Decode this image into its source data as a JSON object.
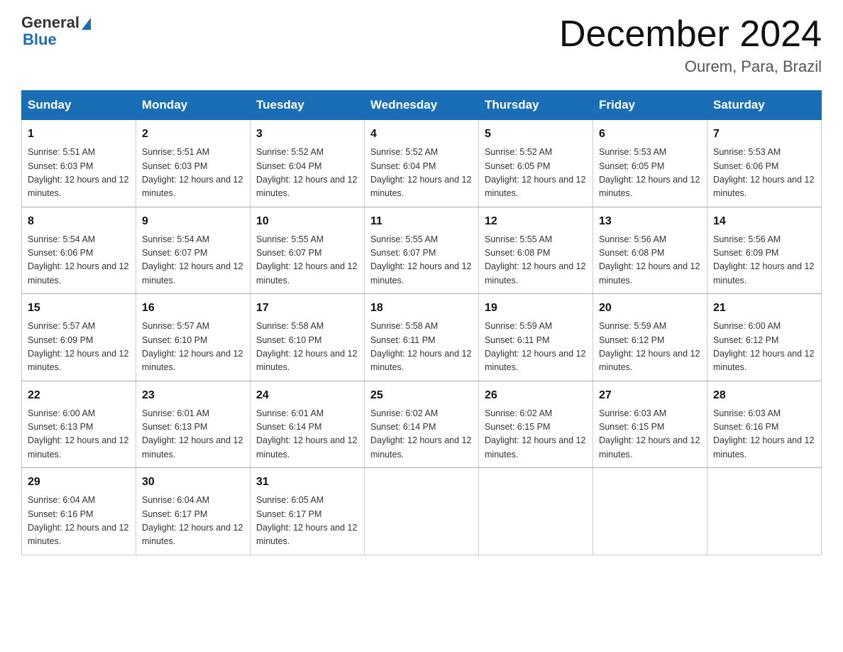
{
  "logo": {
    "text_general": "General",
    "text_blue": "Blue"
  },
  "header": {
    "title": "December 2024",
    "subtitle": "Ourem, Para, Brazil"
  },
  "days_of_week": [
    "Sunday",
    "Monday",
    "Tuesday",
    "Wednesday",
    "Thursday",
    "Friday",
    "Saturday"
  ],
  "weeks": [
    [
      {
        "day": "1",
        "sunrise": "5:51 AM",
        "sunset": "6:03 PM",
        "daylight": "12 hours and 12 minutes."
      },
      {
        "day": "2",
        "sunrise": "5:51 AM",
        "sunset": "6:03 PM",
        "daylight": "12 hours and 12 minutes."
      },
      {
        "day": "3",
        "sunrise": "5:52 AM",
        "sunset": "6:04 PM",
        "daylight": "12 hours and 12 minutes."
      },
      {
        "day": "4",
        "sunrise": "5:52 AM",
        "sunset": "6:04 PM",
        "daylight": "12 hours and 12 minutes."
      },
      {
        "day": "5",
        "sunrise": "5:52 AM",
        "sunset": "6:05 PM",
        "daylight": "12 hours and 12 minutes."
      },
      {
        "day": "6",
        "sunrise": "5:53 AM",
        "sunset": "6:05 PM",
        "daylight": "12 hours and 12 minutes."
      },
      {
        "day": "7",
        "sunrise": "5:53 AM",
        "sunset": "6:06 PM",
        "daylight": "12 hours and 12 minutes."
      }
    ],
    [
      {
        "day": "8",
        "sunrise": "5:54 AM",
        "sunset": "6:06 PM",
        "daylight": "12 hours and 12 minutes."
      },
      {
        "day": "9",
        "sunrise": "5:54 AM",
        "sunset": "6:07 PM",
        "daylight": "12 hours and 12 minutes."
      },
      {
        "day": "10",
        "sunrise": "5:55 AM",
        "sunset": "6:07 PM",
        "daylight": "12 hours and 12 minutes."
      },
      {
        "day": "11",
        "sunrise": "5:55 AM",
        "sunset": "6:07 PM",
        "daylight": "12 hours and 12 minutes."
      },
      {
        "day": "12",
        "sunrise": "5:55 AM",
        "sunset": "6:08 PM",
        "daylight": "12 hours and 12 minutes."
      },
      {
        "day": "13",
        "sunrise": "5:56 AM",
        "sunset": "6:08 PM",
        "daylight": "12 hours and 12 minutes."
      },
      {
        "day": "14",
        "sunrise": "5:56 AM",
        "sunset": "6:09 PM",
        "daylight": "12 hours and 12 minutes."
      }
    ],
    [
      {
        "day": "15",
        "sunrise": "5:57 AM",
        "sunset": "6:09 PM",
        "daylight": "12 hours and 12 minutes."
      },
      {
        "day": "16",
        "sunrise": "5:57 AM",
        "sunset": "6:10 PM",
        "daylight": "12 hours and 12 minutes."
      },
      {
        "day": "17",
        "sunrise": "5:58 AM",
        "sunset": "6:10 PM",
        "daylight": "12 hours and 12 minutes."
      },
      {
        "day": "18",
        "sunrise": "5:58 AM",
        "sunset": "6:11 PM",
        "daylight": "12 hours and 12 minutes."
      },
      {
        "day": "19",
        "sunrise": "5:59 AM",
        "sunset": "6:11 PM",
        "daylight": "12 hours and 12 minutes."
      },
      {
        "day": "20",
        "sunrise": "5:59 AM",
        "sunset": "6:12 PM",
        "daylight": "12 hours and 12 minutes."
      },
      {
        "day": "21",
        "sunrise": "6:00 AM",
        "sunset": "6:12 PM",
        "daylight": "12 hours and 12 minutes."
      }
    ],
    [
      {
        "day": "22",
        "sunrise": "6:00 AM",
        "sunset": "6:13 PM",
        "daylight": "12 hours and 12 minutes."
      },
      {
        "day": "23",
        "sunrise": "6:01 AM",
        "sunset": "6:13 PM",
        "daylight": "12 hours and 12 minutes."
      },
      {
        "day": "24",
        "sunrise": "6:01 AM",
        "sunset": "6:14 PM",
        "daylight": "12 hours and 12 minutes."
      },
      {
        "day": "25",
        "sunrise": "6:02 AM",
        "sunset": "6:14 PM",
        "daylight": "12 hours and 12 minutes."
      },
      {
        "day": "26",
        "sunrise": "6:02 AM",
        "sunset": "6:15 PM",
        "daylight": "12 hours and 12 minutes."
      },
      {
        "day": "27",
        "sunrise": "6:03 AM",
        "sunset": "6:15 PM",
        "daylight": "12 hours and 12 minutes."
      },
      {
        "day": "28",
        "sunrise": "6:03 AM",
        "sunset": "6:16 PM",
        "daylight": "12 hours and 12 minutes."
      }
    ],
    [
      {
        "day": "29",
        "sunrise": "6:04 AM",
        "sunset": "6:16 PM",
        "daylight": "12 hours and 12 minutes."
      },
      {
        "day": "30",
        "sunrise": "6:04 AM",
        "sunset": "6:17 PM",
        "daylight": "12 hours and 12 minutes."
      },
      {
        "day": "31",
        "sunrise": "6:05 AM",
        "sunset": "6:17 PM",
        "daylight": "12 hours and 12 minutes."
      },
      null,
      null,
      null,
      null
    ]
  ]
}
